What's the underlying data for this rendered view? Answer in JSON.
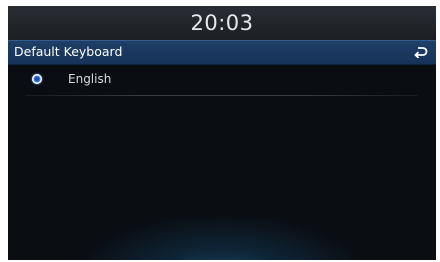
{
  "status_bar": {
    "clock": "20:03"
  },
  "header": {
    "title": "Default Keyboard",
    "back_icon": "back-arrow-icon"
  },
  "keyboard_options": [
    {
      "label": "English",
      "selected": true
    }
  ],
  "colors": {
    "header_background": "#1b3a62",
    "selected_radio": "#3f78e0",
    "screen_background": "#0a0b0e"
  }
}
